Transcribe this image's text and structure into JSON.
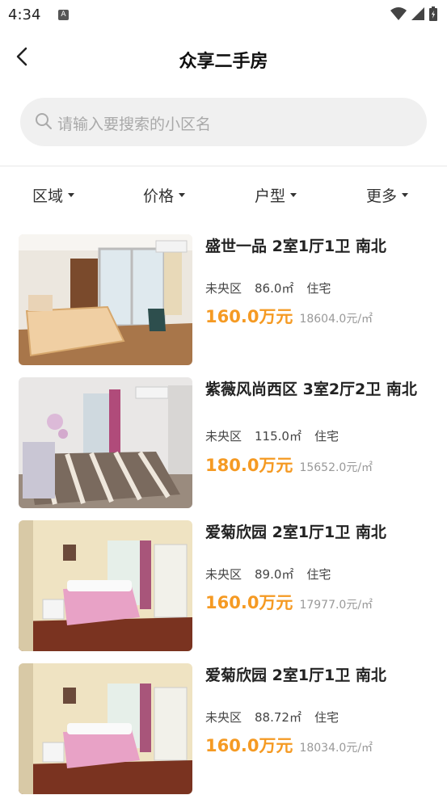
{
  "status": {
    "time": "4:34"
  },
  "header": {
    "title": "众享二手房"
  },
  "search": {
    "placeholder": "请输入要搜索的小区名"
  },
  "filters": [
    "区域",
    "价格",
    "户型",
    "更多"
  ],
  "listings": [
    {
      "title": "盛世一品  2室1厅1卫  南北",
      "district": "未央区",
      "area": "86.0㎡",
      "type": "住宅",
      "price": "160.0万元",
      "unit_price": "18604.0元/㎡"
    },
    {
      "title": "紫薇风尚西区  3室2厅2卫  南北",
      "district": "未央区",
      "area": "115.0㎡",
      "type": "住宅",
      "price": "180.0万元",
      "unit_price": "15652.0元/㎡"
    },
    {
      "title": "爱菊欣园  2室1厅1卫  南北",
      "district": "未央区",
      "area": "89.0㎡",
      "type": "住宅",
      "price": "160.0万元",
      "unit_price": "17977.0元/㎡"
    },
    {
      "title": "爱菊欣园  2室1厅1卫  南北",
      "district": "未央区",
      "area": "88.72㎡",
      "type": "住宅",
      "price": "160.0万元",
      "unit_price": "18034.0元/㎡"
    }
  ]
}
